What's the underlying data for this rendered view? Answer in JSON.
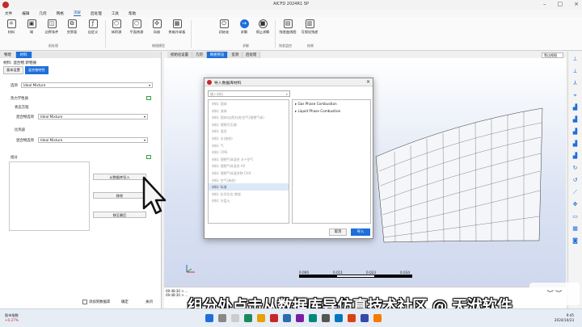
{
  "window": {
    "title": "AICFD 2024R1 SP"
  },
  "menu": [
    "文件",
    "编辑",
    "几何",
    "网格",
    "求解",
    "后处理",
    "工具",
    "帮助"
  ],
  "menu_active": 4,
  "ribbon": {
    "buttons": [
      "材料",
      "域",
      "边界条件",
      "交界面",
      "自定义",
      "体积源",
      "平面热源",
      "风扇",
      "热电冷却板",
      "初始化",
      "求解",
      "停止求解",
      "残差曲线图",
      "可视化残差"
    ],
    "groups": [
      "前处理",
      "物理模型",
      "求解",
      "残差监控",
      "结果"
    ]
  },
  "left_panel": {
    "tabs": [
      "物理",
      "材料"
    ],
    "header": "材料: 混合物 新物质",
    "subtabs": [
      "基本设置",
      "混合物特性"
    ],
    "type_label": "选项",
    "type_value": "Ideal Mixture",
    "thermo_label": "热力学性质",
    "state_label": "状态方程",
    "mix_rule_label": "混合物选项",
    "mix_rule_value": "Ideal Mixture",
    "ratio_label": "比热容",
    "ratio_rule_label": "混合物选项",
    "ratio_rule_value": "Ideal Mixture",
    "components_label": "组分",
    "import_button": "从数据库导入",
    "delete_button": "移除",
    "last_button": "移至最后",
    "add_checkbox": "添加到数据库",
    "apply_button": "确定",
    "close_button": "关闭"
  },
  "view_tabs": [
    "初始化设置",
    "几何",
    "网格预览",
    "监测",
    "后处理"
  ],
  "view_tab_active": 2,
  "view_select": "等边视图",
  "scale": {
    "ticks": [
      "0.000",
      "0.011",
      "0.023",
      "0.034"
    ]
  },
  "console": [
    "09:48:30 > ...",
    "09:48:30 > ..."
  ],
  "dialog": {
    "title": "导入数据库材料",
    "search_placeholder": "输入材料",
    "list": [
      "材料: 固体",
      "材料: 流体",
      "材料: 固体(自然对流)空气(理想气体)",
      "材料: 理想可压缩",
      "材料: 混合",
      "材料: 水(液态)",
      "材料: 气",
      "材料: CMS",
      "材料: 理想气体混合 水+空气",
      "材料: 理想气体混合 H2",
      "材料: 理想气体混合物 CH4",
      "材料: 空气(液态)",
      "材料: 标准",
      "材料: 化学反应 燃烧",
      "材料: 分层火"
    ],
    "list_selected": 12,
    "tree": [
      "Gas Phase Combustion",
      "Liquid Phase Combustion"
    ],
    "cancel": "取消",
    "ok": "导入"
  },
  "subtitle": "组分处点击从数据库导入",
  "watermark": "仿真技术社区 @ 天洑软件",
  "taskbar": {
    "weather_label": "股市指数",
    "weather_value": "+0.27%",
    "time": "9:45",
    "date": "2024/10/23"
  },
  "colors": {
    "accent": "#1e6fd9",
    "scale_colors": [
      "#000000",
      "#ffffff",
      "#000000"
    ]
  }
}
